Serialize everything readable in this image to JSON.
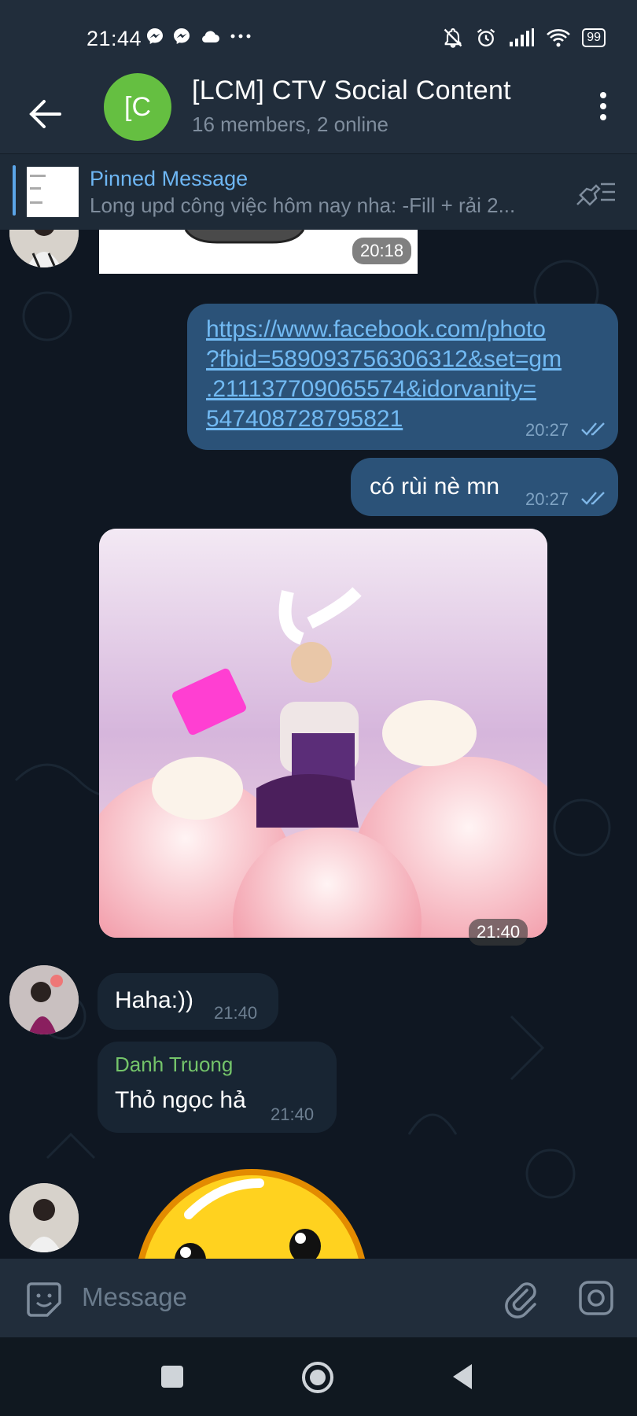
{
  "status_bar": {
    "time": "21:44",
    "notif_icons": [
      "messenger-icon",
      "messenger-icon",
      "cloud-icon",
      "more-dots-icon"
    ],
    "battery": "99"
  },
  "header": {
    "avatar_initials": "[C",
    "title": "[LCM] CTV Social Content",
    "subtitle": "16 members, 2 online"
  },
  "pinned": {
    "title": "Pinned Message",
    "text": "Long upd công việc hôm nay nha: -Fill + rải 2..."
  },
  "messages": {
    "image_top_time": "20:18",
    "link_lines": [
      "https://www.facebook.com/photo",
      "?fbid=589093756306312&set=gm",
      ".211137709065574&idorvanity=",
      "547408728795821"
    ],
    "link_time": "20:27",
    "text_out": "có rùi nè mn",
    "text_out_time": "20:27",
    "photo_time": "21:40",
    "haha_text": "Haha:))",
    "haha_time": "21:40",
    "reply_sender": "Danh Truong",
    "reply_text": "Thỏ ngọc hả",
    "reply_time": "21:40"
  },
  "composer": {
    "placeholder": "Message"
  },
  "colors": {
    "header_bg": "#212d3b",
    "chat_bg": "#0f1722",
    "outgoing_bubble": "#2b5278",
    "incoming_bubble": "#182533",
    "link": "#72baf3",
    "accent_green": "#65bf41"
  }
}
